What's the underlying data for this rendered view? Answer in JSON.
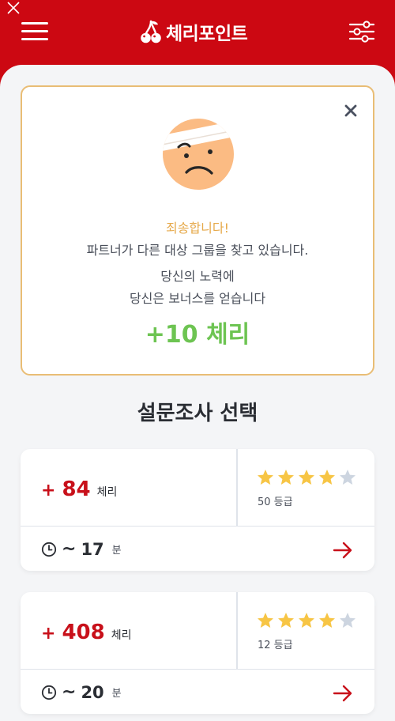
{
  "header": {
    "brand": "체리포인트",
    "icons": {
      "close": "close-icon",
      "menu": "menu-icon",
      "logo": "cherry-icon",
      "filter": "filter-sliders-icon"
    }
  },
  "colors": {
    "brand_red": "#cc0812",
    "bonus_green": "#6dc452",
    "sorry_orange": "#e6a94a",
    "star_gold": "#f7c545",
    "star_gray": "#cdd5e0"
  },
  "notice": {
    "sorry": "죄송합니다!",
    "message": "파트너가 다른 대상 그룹을 찾고 있습니다.",
    "effort": "당신의 노력에",
    "bonus_text": "당신은 보너스를 얻습니다",
    "bonus_amount": "+10 체리"
  },
  "section_title": "설문조사 선택",
  "surveys": [
    {
      "plus": "+",
      "points": "84",
      "points_unit": "체리",
      "stars_filled": 4,
      "stars_total": 5,
      "grade": "50 등급",
      "tilde": "~",
      "minutes": "17",
      "minutes_unit": "분"
    },
    {
      "plus": "+",
      "points": "408",
      "points_unit": "체리",
      "stars_filled": 4,
      "stars_total": 5,
      "grade": "12 등급",
      "tilde": "~",
      "minutes": "20",
      "minutes_unit": "분"
    }
  ]
}
